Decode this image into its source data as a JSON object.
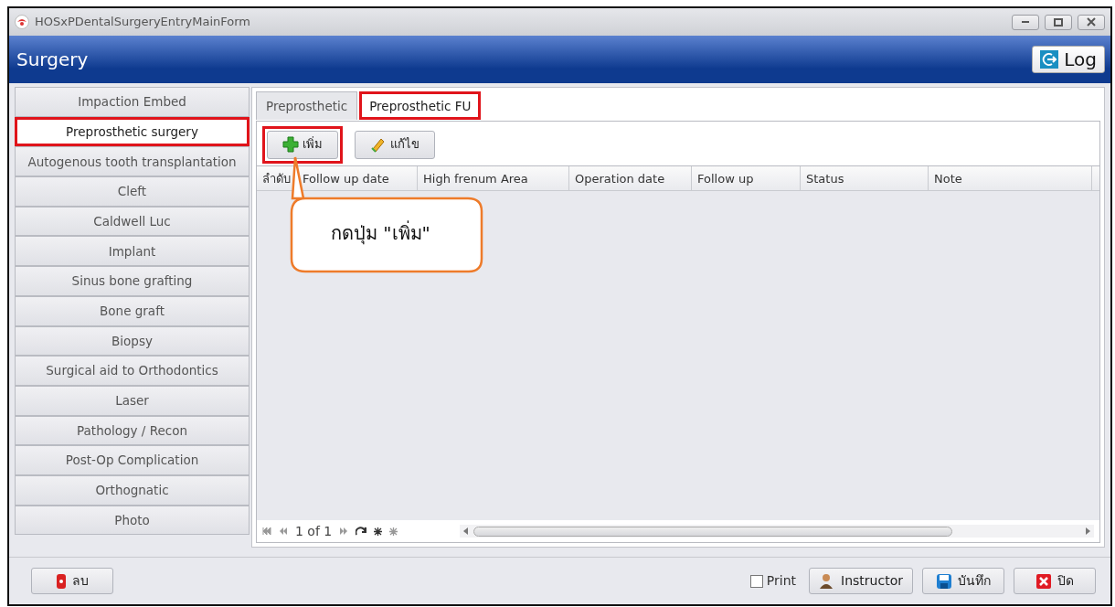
{
  "window": {
    "title": "HOSxPDentalSurgeryEntryMainForm"
  },
  "header": {
    "title": "Surgery",
    "log_button": "Log"
  },
  "sidebar": {
    "items": [
      {
        "label": "Impaction Embed",
        "selected": false,
        "highlighted": false
      },
      {
        "label": "Preprosthetic surgery",
        "selected": true,
        "highlighted": true
      },
      {
        "label": "Autogenous tooth transplantation",
        "selected": false,
        "highlighted": false
      },
      {
        "label": "Cleft",
        "selected": false,
        "highlighted": false
      },
      {
        "label": "Caldwell Luc",
        "selected": false,
        "highlighted": false
      },
      {
        "label": "Implant",
        "selected": false,
        "highlighted": false
      },
      {
        "label": "Sinus bone grafting",
        "selected": false,
        "highlighted": false
      },
      {
        "label": "Bone graft",
        "selected": false,
        "highlighted": false
      },
      {
        "label": "Biopsy",
        "selected": false,
        "highlighted": false
      },
      {
        "label": "Surgical aid to Orthodontics",
        "selected": false,
        "highlighted": false
      },
      {
        "label": "Laser",
        "selected": false,
        "highlighted": false
      },
      {
        "label": "Pathology / Recon",
        "selected": false,
        "highlighted": false
      },
      {
        "label": "Post-Op Complication",
        "selected": false,
        "highlighted": false
      },
      {
        "label": "Orthognatic",
        "selected": false,
        "highlighted": false
      },
      {
        "label": "Photo",
        "selected": false,
        "highlighted": false
      }
    ]
  },
  "tabs": [
    {
      "label": "Preprosthetic",
      "selected": false,
      "highlighted": false
    },
    {
      "label": "Preprosthetic FU",
      "selected": true,
      "highlighted": true
    }
  ],
  "toolbar": [
    {
      "kind": "add",
      "label": "เพิ่ม",
      "highlighted": true
    },
    {
      "kind": "edit",
      "label": "แก้ไข",
      "highlighted": false
    }
  ],
  "table": {
    "columns": [
      "ลำดับ",
      "Follow up date",
      "High frenum Area",
      "Operation date",
      "Follow up",
      "Status",
      "Note"
    ]
  },
  "navigator": {
    "page": "1 of 1"
  },
  "callout": "กดปุ่ม \"เพิ่ม\"",
  "footer": {
    "delete_button": "ลบ",
    "print": {
      "label": "Print",
      "checked": false
    },
    "buttons": [
      {
        "kind": "instructor",
        "label": "Instructor"
      },
      {
        "kind": "save",
        "label": "บันทึก"
      },
      {
        "kind": "close",
        "label": "ปิด"
      }
    ]
  }
}
